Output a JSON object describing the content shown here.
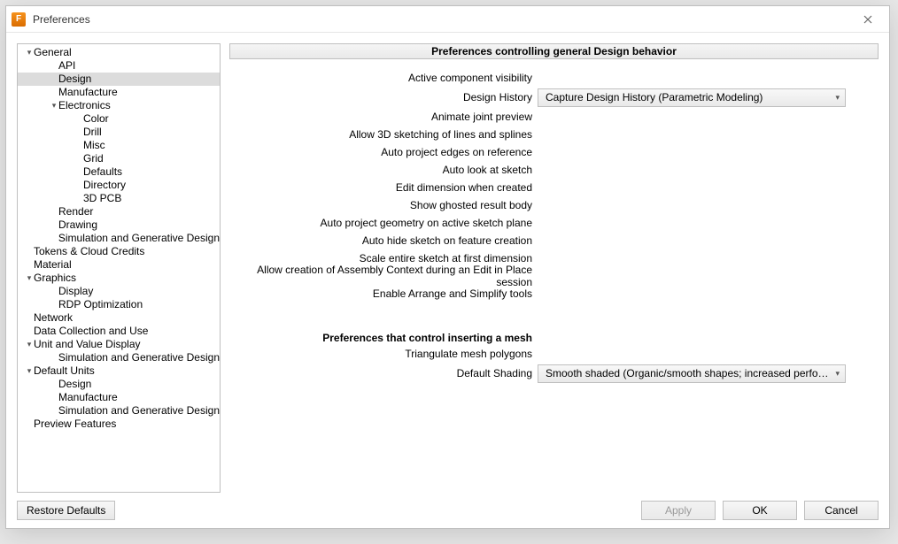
{
  "window": {
    "title": "Preferences"
  },
  "tree": {
    "items": [
      {
        "label": "General",
        "level": 0,
        "caret": "down",
        "selected": false
      },
      {
        "label": "API",
        "level": 1,
        "caret": "none",
        "selected": false
      },
      {
        "label": "Design",
        "level": 1,
        "caret": "none",
        "selected": true
      },
      {
        "label": "Manufacture",
        "level": 1,
        "caret": "none",
        "selected": false
      },
      {
        "label": "Electronics",
        "level": 1,
        "caret": "down",
        "selected": false
      },
      {
        "label": "Color",
        "level": 2,
        "caret": "none",
        "selected": false
      },
      {
        "label": "Drill",
        "level": 2,
        "caret": "none",
        "selected": false
      },
      {
        "label": "Misc",
        "level": 2,
        "caret": "none",
        "selected": false
      },
      {
        "label": "Grid",
        "level": 2,
        "caret": "none",
        "selected": false
      },
      {
        "label": "Defaults",
        "level": 2,
        "caret": "none",
        "selected": false
      },
      {
        "label": "Directory",
        "level": 2,
        "caret": "none",
        "selected": false
      },
      {
        "label": "3D PCB",
        "level": 2,
        "caret": "none",
        "selected": false
      },
      {
        "label": "Render",
        "level": 1,
        "caret": "none",
        "selected": false
      },
      {
        "label": "Drawing",
        "level": 1,
        "caret": "none",
        "selected": false
      },
      {
        "label": "Simulation and Generative Design",
        "level": 1,
        "caret": "none",
        "selected": false
      },
      {
        "label": "Tokens & Cloud Credits",
        "level": 0,
        "caret": "none",
        "selected": false
      },
      {
        "label": "Material",
        "level": 0,
        "caret": "none",
        "selected": false
      },
      {
        "label": "Graphics",
        "level": 0,
        "caret": "down",
        "selected": false
      },
      {
        "label": "Display",
        "level": 1,
        "caret": "none",
        "selected": false
      },
      {
        "label": "RDP Optimization",
        "level": 1,
        "caret": "none",
        "selected": false
      },
      {
        "label": "Network",
        "level": 0,
        "caret": "none",
        "selected": false
      },
      {
        "label": "Data Collection and Use",
        "level": 0,
        "caret": "none",
        "selected": false
      },
      {
        "label": "Unit and Value Display",
        "level": 0,
        "caret": "down",
        "selected": false
      },
      {
        "label": "Simulation and Generative Design",
        "level": 1,
        "caret": "none",
        "selected": false
      },
      {
        "label": "Default Units",
        "level": 0,
        "caret": "down",
        "selected": false
      },
      {
        "label": "Design",
        "level": 1,
        "caret": "none",
        "selected": false
      },
      {
        "label": "Manufacture",
        "level": 1,
        "caret": "none",
        "selected": false
      },
      {
        "label": "Simulation and Generative Design",
        "level": 1,
        "caret": "none",
        "selected": false
      },
      {
        "label": "Preview Features",
        "level": 0,
        "caret": "none",
        "selected": false
      }
    ]
  },
  "panel": {
    "section_title": "Preferences controlling general Design behavior",
    "rows": [
      {
        "label": "Active component visibility"
      },
      {
        "label": "Design History",
        "select": "Capture Design History (Parametric Modeling)"
      },
      {
        "label": "Animate joint preview"
      },
      {
        "label": "Allow 3D sketching of lines and splines"
      },
      {
        "label": "Auto project edges on reference"
      },
      {
        "label": "Auto look at sketch"
      },
      {
        "label": "Edit dimension when created"
      },
      {
        "label": "Show ghosted result body"
      },
      {
        "label": "Auto project geometry on active sketch plane"
      },
      {
        "label": "Auto hide sketch on feature creation"
      },
      {
        "label": "Scale entire sketch at first dimension"
      },
      {
        "label": "Allow creation of Assembly Context during an Edit in Place session"
      },
      {
        "label": "Enable Arrange and Simplify tools"
      }
    ],
    "subsection_title": "Preferences that control inserting a mesh",
    "rows2": [
      {
        "label": "Triangulate mesh polygons"
      },
      {
        "label": "Default Shading",
        "select": "Smooth shaded (Organic/smooth shapes; increased performance)"
      }
    ]
  },
  "footer": {
    "restore": "Restore Defaults",
    "apply": "Apply",
    "ok": "OK",
    "cancel": "Cancel"
  }
}
